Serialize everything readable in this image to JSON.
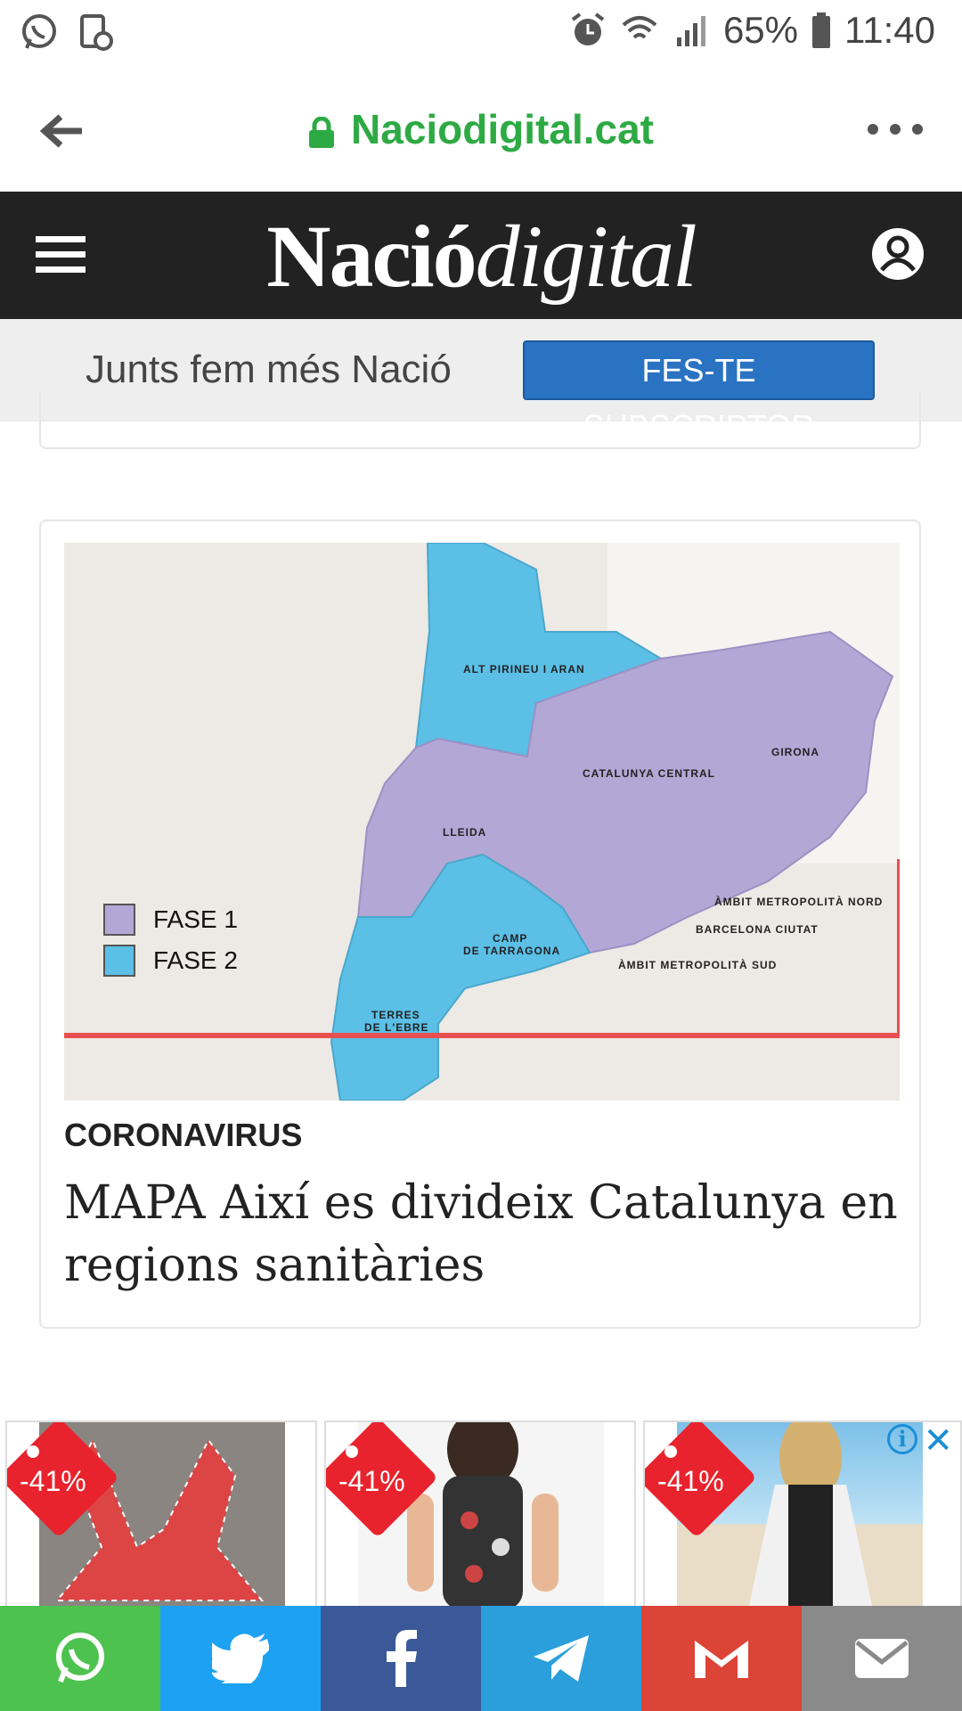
{
  "status_bar": {
    "battery": "65%",
    "time": "11:40",
    "icons": [
      "whatsapp-icon",
      "screenshot-icon",
      "alarm-icon",
      "wifi-icon",
      "signal-icon",
      "battery-icon"
    ]
  },
  "browser": {
    "url": "Naciodigital.cat",
    "icons": [
      "back-arrow-icon",
      "lock-icon",
      "more-icon"
    ]
  },
  "site_header": {
    "logo_part1": "Nació",
    "logo_part2": "digital",
    "icons": [
      "menu-icon",
      "user-icon"
    ]
  },
  "promo": {
    "text": "Junts fem més Nació",
    "button": "FES-TE SUBSCRIPTOR"
  },
  "article": {
    "map": {
      "legend": [
        {
          "label": "FASE 1",
          "color": "#b3a7d6"
        },
        {
          "label": "FASE 2",
          "color": "#5bbfe6"
        }
      ],
      "regions": {
        "alt_pirineu": "ALT PIRINEU I ARAN",
        "catalunya_central": "CATALUNYA CENTRAL",
        "girona": "GIRONA",
        "lleida": "LLEIDA",
        "ambit_nord": "ÀMBIT METROPOLITÀ NORD",
        "barcelona": "BARCELONA CIUTAT",
        "camp_tarragona_1": "CAMP",
        "camp_tarragona_2": "DE TARRAGONA",
        "ambit_sud": "ÀMBIT METROPOLITÀ SUD",
        "terres_ebre_1": "TERRES",
        "terres_ebre_2": "DE L'EBRE"
      }
    },
    "category": "CORONAVIRUS",
    "headline": "MAPA Així es divideix Catalunya en regions sanitàries"
  },
  "ads": {
    "items": [
      {
        "discount": "-41%"
      },
      {
        "discount": "-41%"
      },
      {
        "discount": "-41%"
      }
    ],
    "icons": [
      "info-icon",
      "close-icon"
    ],
    "info_glyph": "i",
    "close_glyph": "✕"
  },
  "share": {
    "buttons": [
      {
        "name": "whatsapp",
        "color": "#4ec24e"
      },
      {
        "name": "twitter",
        "color": "#1da1f2"
      },
      {
        "name": "facebook",
        "color": "#3b5998"
      },
      {
        "name": "telegram",
        "color": "#2a9fdc"
      },
      {
        "name": "gmail",
        "color": "#db4437"
      },
      {
        "name": "email",
        "color": "#8a8a8a"
      }
    ]
  }
}
